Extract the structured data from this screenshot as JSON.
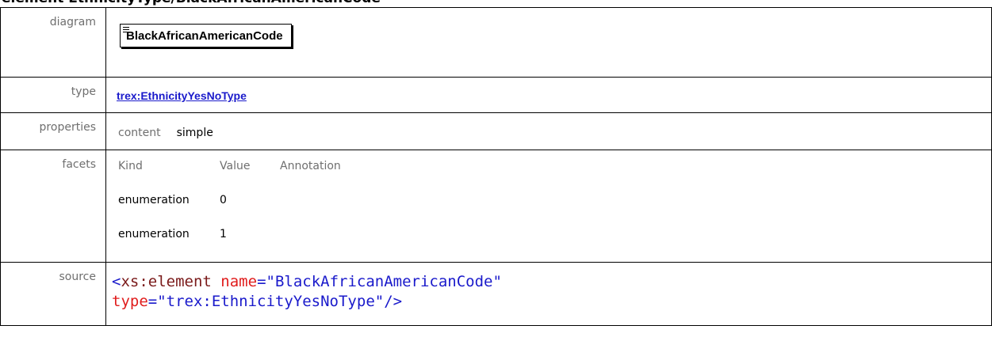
{
  "heading": "element EthnicityType/BlackAfricanAmericanCode",
  "rows": {
    "diagram": {
      "label": "diagram",
      "element_name": "BlackAfricanAmericanCode"
    },
    "type": {
      "label": "type",
      "link_text": "trex:EthnicityYesNoType"
    },
    "properties": {
      "label": "properties",
      "key": "content",
      "value": "simple"
    },
    "facets": {
      "label": "facets",
      "headers": [
        "Kind",
        "Value",
        "Annotation"
      ],
      "items": [
        {
          "kind": "enumeration",
          "value": "0"
        },
        {
          "kind": "enumeration",
          "value": "1"
        }
      ]
    },
    "source": {
      "label": "source",
      "open_bracket": "<",
      "tag_name": "xs:element",
      "attr1_name": "name",
      "attr1_value": "\"BlackAfricanAmericanCode\"",
      "attr2_name": "type",
      "attr2_value": "\"trex:EthnicityYesNoType\"",
      "close": "/>",
      "eq": "="
    }
  },
  "colors": {
    "label_gray": "#6f6f6f",
    "link_blue": "#1a1acb",
    "attr_red": "#e01c1c",
    "tag_brown": "#7a1a1a"
  }
}
